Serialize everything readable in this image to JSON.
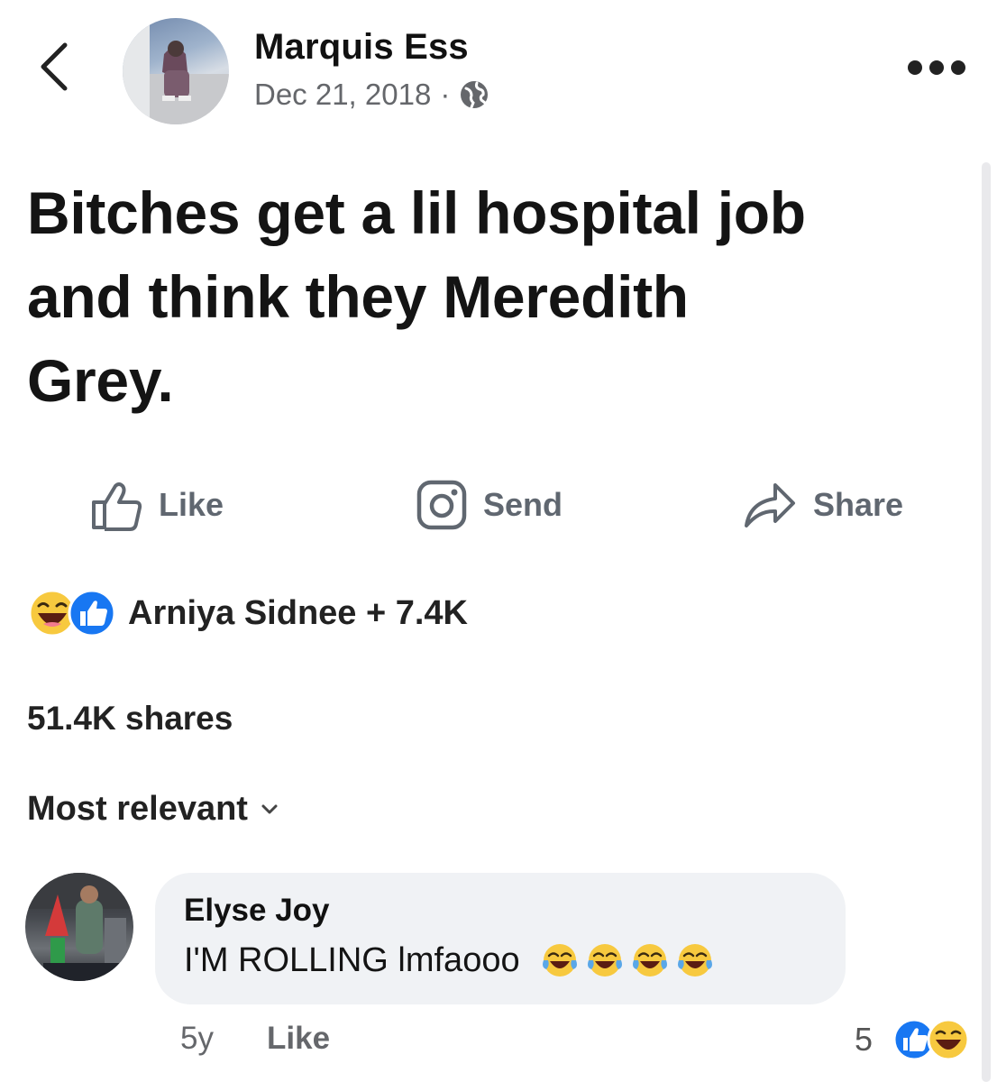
{
  "header": {
    "author_name": "Marquis Ess",
    "date": "Dec 21, 2018",
    "separator": "·",
    "privacy_icon": "globe-icon",
    "back_icon": "chevron-left-icon",
    "more_icon": "more-dots-icon"
  },
  "post": {
    "lines": [
      "Bitches get a lil hospital job",
      "and think they Meredith",
      "Grey."
    ]
  },
  "actions": {
    "like_label": "Like",
    "send_label": "Send",
    "share_label": "Share"
  },
  "reactions": {
    "summary": "Arniya Sidnee + 7.4K",
    "icons": [
      "haha-reaction-icon",
      "like-reaction-icon"
    ]
  },
  "shares_text": "51.4K shares",
  "sort": {
    "label": "Most relevant",
    "icon": "chevron-down-icon"
  },
  "comment": {
    "author": "Elyse Joy",
    "text": "I'M ROLLING lmfaooo",
    "emoji_count": 4,
    "emoji": "tears-of-joy-emoji",
    "age": "5y",
    "like_label": "Like",
    "reaction_count": "5"
  },
  "colors": {
    "secondary_text": "#65676b",
    "like_blue": "#1877f2",
    "haha_yellow": "#f7c93f",
    "bubble_bg": "#f0f2f5"
  }
}
